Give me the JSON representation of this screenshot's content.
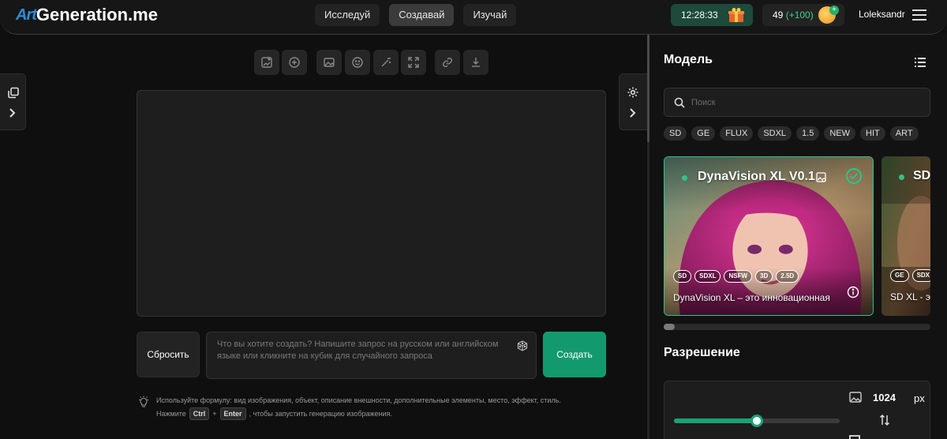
{
  "header": {
    "logo_art": "Art",
    "logo_rest": "Generation.me",
    "nav": [
      "Исследуй",
      "Создавай",
      "Изучай"
    ],
    "nav_active": "Создавай",
    "timer": "12:28:33",
    "coins": "49",
    "coins_bonus": "(+100)",
    "username": "Loleksandr"
  },
  "editor": {
    "reset_label": "Сбросить",
    "prompt_placeholder": "Что вы хотите создать? Напишите запрос на русском или английском языке или кликните на кубик для случайного запроса",
    "create_label": "Создать",
    "hint_line1": "Используйте формулу: вид изображения, объект, описание внешности, дополнительные элементы, место, эффект, стиль.",
    "hint_press": "Нажмите",
    "hint_key1": "Ctrl",
    "hint_plus": "+",
    "hint_key2": "Enter",
    "hint_rest": ", чтобы запустить генерацию изображения."
  },
  "panel": {
    "model_heading": "Модель",
    "search_placeholder": "Поиск",
    "filters": [
      "SD",
      "GE",
      "FLUX",
      "SDXL",
      "1.5",
      "NEW",
      "HIT",
      "ART"
    ],
    "cards": [
      {
        "title": "DynaVision XL V0.1",
        "tags": [
          "SD",
          "SDXL",
          "NSFW",
          "3D",
          "2.5D"
        ],
        "description": "DynaVision XL – это инновационная",
        "selected": true
      },
      {
        "title": "SD",
        "tags": [
          "GE",
          "SDX"
        ],
        "description": "SD XL - э",
        "selected": false
      }
    ],
    "resolution_heading": "Разрешение",
    "width_value": "1024",
    "unit": "px",
    "slider_fraction": 0.5
  },
  "colors": {
    "accent": "#129a6e",
    "selected_border": "#2fc38a",
    "timer_bg": "#1d4a3a"
  }
}
